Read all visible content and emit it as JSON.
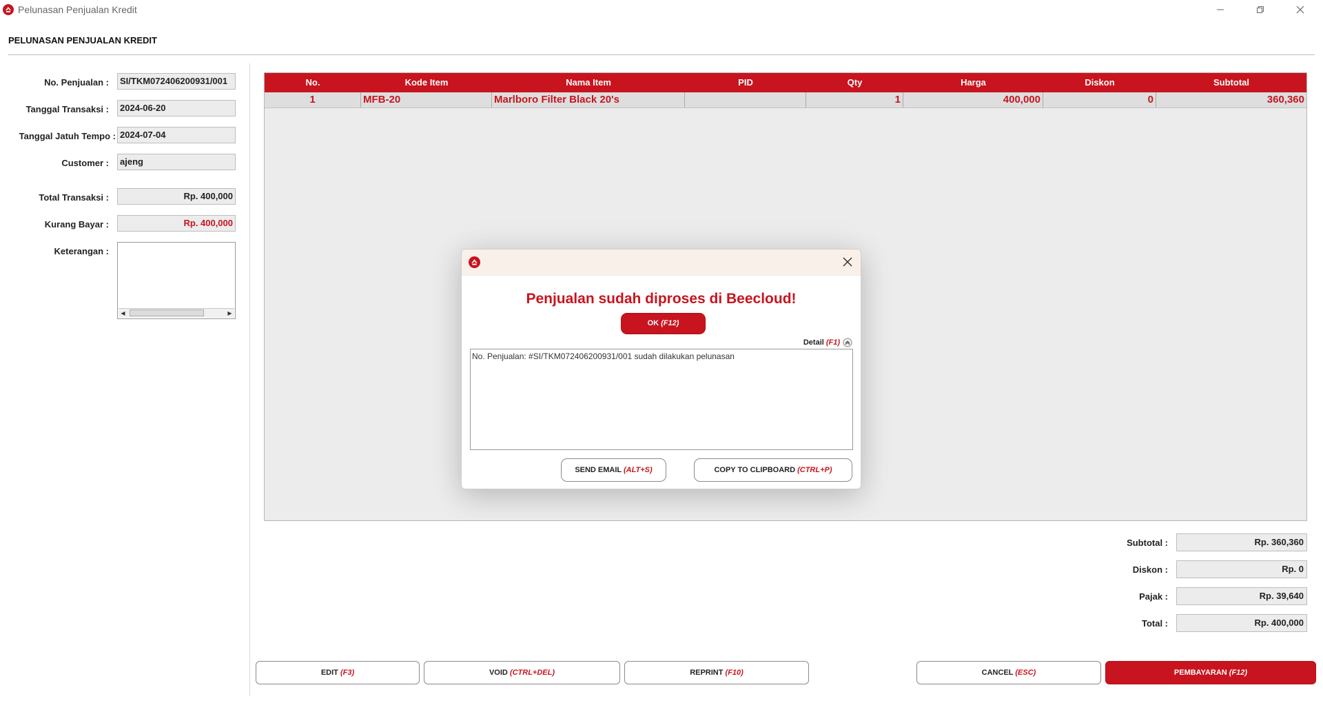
{
  "window": {
    "title": "Pelunasan Penjualan Kredit"
  },
  "page": {
    "heading": "PELUNASAN PENJUALAN KREDIT"
  },
  "form": {
    "no_penjualan_label": "No. Penjualan :",
    "no_penjualan_value": "SI/TKM072406200931/001",
    "tanggal_transaksi_label": "Tanggal Transaksi :",
    "tanggal_transaksi_value": "2024-06-20",
    "tanggal_jatuh_tempo_label": "Tanggal Jatuh Tempo :",
    "tanggal_jatuh_tempo_value": "2024-07-04",
    "customer_label": "Customer :",
    "customer_value": "ajeng",
    "total_transaksi_label": "Total Transaksi :",
    "total_transaksi_value": "Rp. 400,000",
    "kurang_bayar_label": "Kurang Bayar :",
    "kurang_bayar_value": "Rp. 400,000",
    "keterangan_label": "Keterangan :",
    "keterangan_value": ""
  },
  "table": {
    "columns": [
      "No.",
      "Kode Item",
      "Nama Item",
      "PID",
      "Qty",
      "Harga",
      "Diskon",
      "Subtotal"
    ],
    "rows": [
      {
        "no": "1",
        "kode_item": "MFB-20",
        "nama_item": "Marlboro Filter Black 20's",
        "pid": "",
        "qty": "1",
        "harga": "400,000",
        "diskon": "0",
        "subtotal": "360,360"
      }
    ]
  },
  "summary": {
    "subtotal_label": "Subtotal :",
    "subtotal_value": "Rp. 360,360",
    "diskon_label": "Diskon :",
    "diskon_value": "Rp. 0",
    "pajak_label": "Pajak :",
    "pajak_value": "Rp. 39,640",
    "total_label": "Total :",
    "total_value": "Rp. 400,000"
  },
  "buttons": {
    "edit": {
      "label": "EDIT",
      "hotkey": "(F3)"
    },
    "void": {
      "label": "VOID",
      "hotkey": "(CTRL+DEL)"
    },
    "reprint": {
      "label": "REPRINT",
      "hotkey": "(F10)"
    },
    "cancel": {
      "label": "CANCEL",
      "hotkey": "(ESC)"
    },
    "pembayaran": {
      "label": "PEMBAYARAN",
      "hotkey": "(F12)"
    }
  },
  "dialog": {
    "message": "Penjualan sudah diproses di Beecloud!",
    "ok": {
      "label": "OK",
      "hotkey": "(F12)"
    },
    "detail_label": "Detail",
    "detail_hotkey": "(F1)",
    "detail_text": "No. Penjualan: #SI/TKM072406200931/001 sudah dilakukan pelunasan",
    "send_email": {
      "label": "SEND EMAIL",
      "hotkey": "(ALT+S)"
    },
    "copy_clipboard": {
      "label": "COPY TO CLIPBOARD",
      "hotkey": "(CTRL+P)"
    }
  },
  "colors": {
    "accent": "#c8141e",
    "header_bg": "#faf0ea"
  },
  "icons": {
    "app": "beecloud-logo-icon",
    "minimize": "minimize-icon",
    "restore": "restore-icon",
    "close": "close-icon",
    "dialog_close": "close-icon",
    "detail_toggle": "chevron-up-circle-icon"
  }
}
